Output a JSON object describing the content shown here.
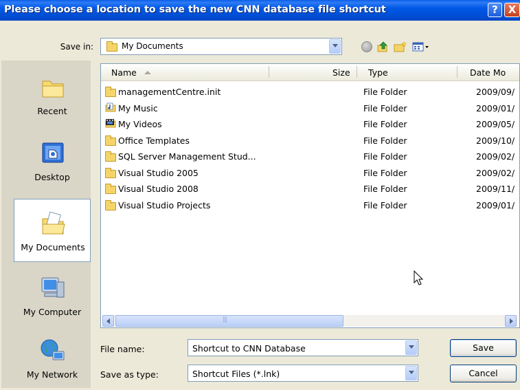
{
  "window": {
    "title": "Please choose a location to save the new CNN database file shortcut",
    "help_label": "?",
    "close_label": "X"
  },
  "save_in": {
    "label": "Save in:",
    "value": "My Documents"
  },
  "places": [
    {
      "label": "Recent",
      "icon": "recent-folder-icon"
    },
    {
      "label": "Desktop",
      "icon": "desktop-icon"
    },
    {
      "label": "My Documents",
      "icon": "my-documents-icon",
      "selected": true
    },
    {
      "label": "My Computer",
      "icon": "my-computer-icon"
    },
    {
      "label": "My Network",
      "icon": "my-network-icon"
    }
  ],
  "file_list": {
    "columns": [
      "Name",
      "Size",
      "Type",
      "Date Mo"
    ],
    "sort_column": "Name",
    "rows": [
      {
        "name": "managementCentre.init",
        "type": "File Folder",
        "date": "2009/09/",
        "icon": "folder-icon"
      },
      {
        "name": "My Music",
        "type": "File Folder",
        "date": "2009/01/",
        "icon": "music-folder-icon"
      },
      {
        "name": "My Videos",
        "type": "File Folder",
        "date": "2009/05/",
        "icon": "video-folder-icon"
      },
      {
        "name": "Office Templates",
        "type": "File Folder",
        "date": "2009/10/",
        "icon": "folder-icon"
      },
      {
        "name": "SQL Server Management Stud...",
        "type": "File Folder",
        "date": "2009/02/",
        "icon": "folder-icon"
      },
      {
        "name": "Visual Studio 2005",
        "type": "File Folder",
        "date": "2009/02/",
        "icon": "folder-icon"
      },
      {
        "name": "Visual Studio 2008",
        "type": "File Folder",
        "date": "2009/11/",
        "icon": "folder-icon"
      },
      {
        "name": "Visual Studio Projects",
        "type": "File Folder",
        "date": "2009/01/",
        "icon": "folder-icon"
      }
    ]
  },
  "file_name": {
    "label": "File name:",
    "value": "Shortcut to CNN Database"
  },
  "save_as_type": {
    "label": "Save as type:",
    "value": "Shortcut Files (*.lnk)"
  },
  "buttons": {
    "save": "Save",
    "cancel": "Cancel"
  },
  "colors": {
    "title_bar": "#0058E6",
    "dialog_bg": "#ECE9D8",
    "folder": "#F5D56A"
  }
}
